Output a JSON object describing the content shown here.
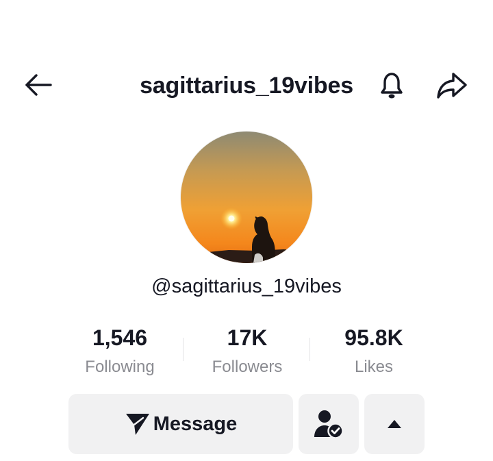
{
  "header": {
    "username_title": "sagittarius_19vibes",
    "back_icon": "arrow-left-icon",
    "notification_icon": "bell-icon",
    "share_icon": "share-arrow-icon"
  },
  "profile": {
    "avatar_description_icon": "sunset-profile-photo",
    "handle": "@sagittarius_19vibes"
  },
  "stats": [
    {
      "value": "1,546",
      "label": "Following"
    },
    {
      "value": "17K",
      "label": "Followers"
    },
    {
      "value": "95.8K",
      "label": "Likes"
    }
  ],
  "actions": {
    "message_label": "Message",
    "message_icon": "send-plane-icon",
    "following_icon": "user-check-icon",
    "more_icon": "caret-up-icon"
  },
  "colors": {
    "text_primary": "#161823",
    "text_secondary": "#8a8b91",
    "button_bg": "#f1f1f2"
  }
}
